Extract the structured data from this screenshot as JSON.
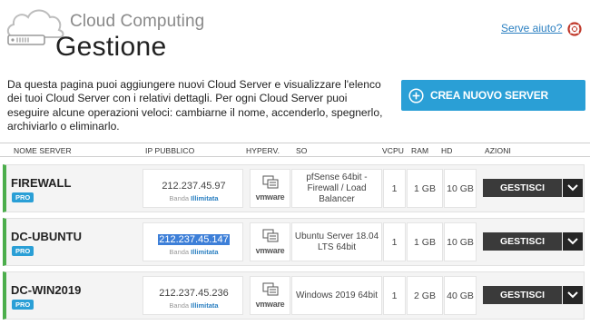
{
  "header": {
    "brand": "Cloud Computing",
    "title": "Gestione",
    "help_link": "Serve aiuto?"
  },
  "intro": "Da questa pagina puoi aggiungere nuovi Cloud Server e visualizzare l'elenco dei tuoi Cloud Server con i relativi dettagli. Per ogni Cloud Server puoi eseguire alcune operazioni veloci: cambiarne il nome, accenderlo, spegnerlo, archiviarlo o eliminarlo.",
  "create_button": {
    "label": "CREA NUOVO SERVER"
  },
  "columns": [
    "NOME SERVER",
    "IP PUBBLICO",
    "HYPERV.",
    "SO",
    "VCPU",
    "RAM",
    "HD",
    "AZIONI"
  ],
  "servers": [
    {
      "name": "FIREWALL",
      "badge": "PRO",
      "ip": "212.237.45.97",
      "band_label": "Banda",
      "band_value": "Illimitata",
      "hypervisor": "vmware",
      "os": "pfSense 64bit - Firewall / Load Balancer",
      "vcpu": "1",
      "ram": "1 GB",
      "hd": "10 GB",
      "action": "GESTISCI",
      "selected_ip": false
    },
    {
      "name": "DC-UBUNTU",
      "badge": "PRO",
      "ip": "212.237.45.147",
      "band_label": "Banda",
      "band_value": "Illimitata",
      "hypervisor": "vmware",
      "os": "Ubuntu Server 18.04 LTS 64bit",
      "vcpu": "1",
      "ram": "1 GB",
      "hd": "10 GB",
      "action": "GESTISCI",
      "selected_ip": true
    },
    {
      "name": "DC-WIN2019",
      "badge": "PRO",
      "ip": "212.237.45.236",
      "band_label": "Banda",
      "band_value": "Illimitata",
      "hypervisor": "vmware",
      "os": "Windows 2019 64bit",
      "vcpu": "1",
      "ram": "2 GB",
      "hd": "40 GB",
      "action": "GESTISCI",
      "selected_ip": false
    }
  ],
  "colors": {
    "accent": "#2a9fd6",
    "row_status": "#4cae4c",
    "button_dark": "#3a3a3a",
    "ip_selection": "#3d7fd8"
  },
  "icons": {
    "logo": "cloud-server-icon",
    "help": "lifebuoy-icon",
    "create": "plus-circle-icon",
    "hypervisor": "vmware-server-icon",
    "dropdown": "chevron-down-icon"
  }
}
